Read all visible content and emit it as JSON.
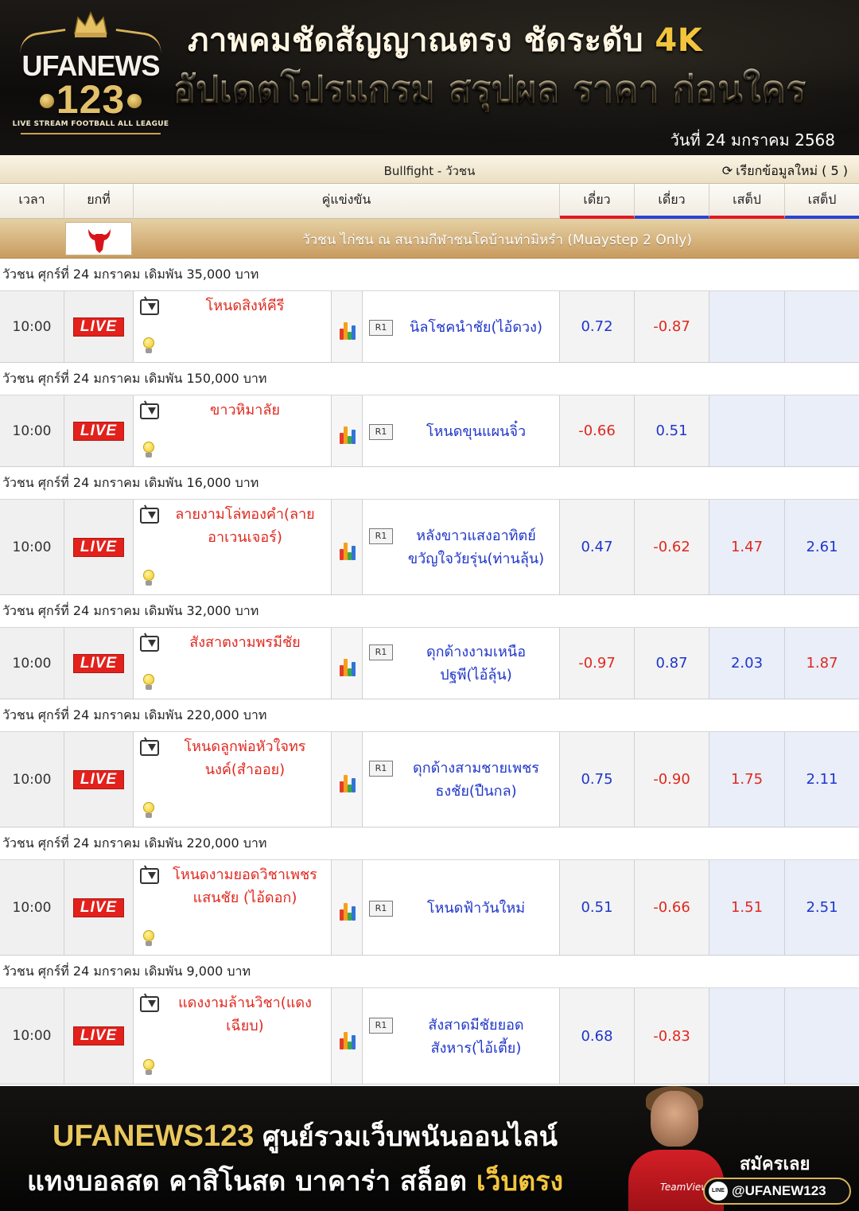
{
  "header": {
    "logo_brand": "UFANEWS",
    "logo_number": "123",
    "logo_tagline": "LIVE STREAM FOOTBALL ALL LEAGUE",
    "headline_part1": "ภาพคมชัดสัญญาณตรง ชัดระดับ ",
    "headline_part2": "4K",
    "subheadline": "อัปเดตโปรแกรม สรุปผล ราคา ก่อนใคร",
    "date": "วันที่ 24 มกราคม 2568"
  },
  "board": {
    "title": "Bullfight - วัวชน",
    "reload_label": "เรียกข้อมูลใหม่ ( 5 )",
    "columns": {
      "time": "เวลา",
      "round": "ยกที่",
      "match": "คู่แข่งขัน",
      "odd1": "เดี่ยว",
      "odd2": "เดี่ยว",
      "odd3": "เสต็ป",
      "odd4": "เสต็ป"
    },
    "league_name": "วัวชน ไก่ชน ณ สนามกีฬาชนโคบ้านท่ามิหรำ (Muaystep 2 Only)",
    "live_label": "LIVE",
    "round_label": "R1",
    "matches": [
      {
        "day": "วัวชน ศุกร์ที่ 24 มกราคม เดิมพัน 35,000 บาท",
        "time": "10:00",
        "home": [
          "โหนดสิงห์คีรี"
        ],
        "away": [
          "นิลโชคนำชัย(ไอ้ดวง)"
        ],
        "odds": [
          "0.72",
          "-0.87",
          "",
          ""
        ],
        "colors": [
          "blue",
          "red",
          "red",
          "blue"
        ]
      },
      {
        "day": "วัวชน ศุกร์ที่ 24 มกราคม เดิมพัน 150,000 บาท",
        "time": "10:00",
        "home": [
          "ขาวหิมาลัย"
        ],
        "away": [
          "โหนดขุนแผนจิ๋ว"
        ],
        "odds": [
          "-0.66",
          "0.51",
          "",
          ""
        ],
        "colors": [
          "red",
          "blue",
          "red",
          "blue"
        ]
      },
      {
        "day": "วัวชน ศุกร์ที่ 24 มกราคม เดิมพัน 16,000 บาท",
        "time": "10:00",
        "home": [
          "ลายงามโล่ทองคำ(ลาย",
          "อาเวนเจอร์)"
        ],
        "away": [
          "หลังขาวแสงอาทิตย์",
          "ขวัญใจวัยรุ่น(ท่านลุ้น)"
        ],
        "odds": [
          "0.47",
          "-0.62",
          "1.47",
          "2.61"
        ],
        "colors": [
          "blue",
          "red",
          "red",
          "blue"
        ]
      },
      {
        "day": "วัวชน ศุกร์ที่ 24 มกราคม เดิมพัน 32,000 บาท",
        "time": "10:00",
        "home": [
          "สังสาตงามพรมีชัย"
        ],
        "away": [
          "ดุกด้างงามเหนือ",
          "ปฐพี(ไอ้ลุ้น)"
        ],
        "odds": [
          "-0.97",
          "0.87",
          "2.03",
          "1.87"
        ],
        "colors": [
          "red",
          "blue",
          "blue",
          "red"
        ]
      },
      {
        "day": "วัวชน ศุกร์ที่ 24 มกราคม เดิมพัน 220,000 บาท",
        "time": "10:00",
        "home": [
          "โหนดลูกพ่อหัวใจทร",
          "นงค์(สำออย)"
        ],
        "away": [
          "ดุกด้างสามชายเพชร",
          "ธงชัย(ปืนกล)"
        ],
        "odds": [
          "0.75",
          "-0.90",
          "1.75",
          "2.11"
        ],
        "colors": [
          "blue",
          "red",
          "red",
          "blue"
        ]
      },
      {
        "day": "วัวชน ศุกร์ที่ 24 มกราคม เดิมพัน 220,000 บาท",
        "time": "10:00",
        "home": [
          "โหนดงามยอดวิชาเพชร",
          "แสนชัย (ไอ้ดอก)"
        ],
        "away": [
          "โหนดฟ้าวันใหม่"
        ],
        "odds": [
          "0.51",
          "-0.66",
          "1.51",
          "2.51"
        ],
        "colors": [
          "blue",
          "red",
          "red",
          "blue"
        ]
      },
      {
        "day": "วัวชน ศุกร์ที่ 24 มกราคม เดิมพัน 9,000 บาท",
        "time": "10:00",
        "home": [
          "แดงงามล้านวิชา(แดง",
          "เฉียบ)"
        ],
        "away": [
          "สังสาดมีชัยยอด",
          "สังหาร(ไอ้เตี้ย)"
        ],
        "odds": [
          "0.68",
          "-0.83",
          "",
          ""
        ],
        "colors": [
          "blue",
          "red",
          "red",
          "blue"
        ]
      }
    ],
    "icons": {
      "tv": "tv-icon",
      "bulb": "lightbulb-icon",
      "stats": "bar-chart-icon",
      "reload": "refresh-icon",
      "league_logo": "bull-head-icon"
    },
    "accent_colors": {
      "home": "#e0281e",
      "away": "#1f36c9",
      "live": "#e2211c"
    }
  },
  "watermark": {
    "brand": "UFANEWS",
    "number": "123"
  },
  "footer": {
    "brand": "UFANEWS123",
    "slogan": "ศูนย์รวมเว็บพนันออนไลน์",
    "line2_main": "แทงบอลสด คาสิโนสด บาคาร่า สล็อต ",
    "line2_highlight": "เว็บตรง",
    "join_label": "สมัครเลย",
    "line_badge": "LINE",
    "line_id": "@UFANEW123",
    "shirt_sponsor": "TeamViewer"
  }
}
